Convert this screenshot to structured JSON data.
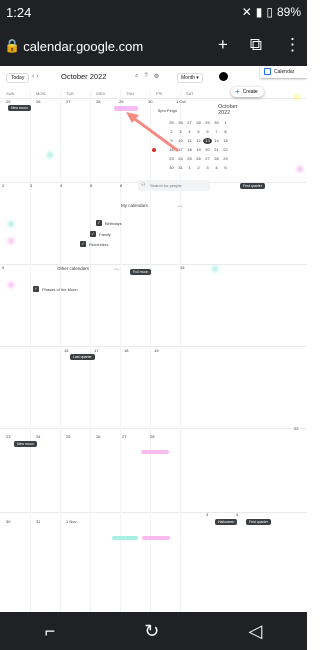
{
  "status_bar": {
    "time": "1:24",
    "battery": "89%"
  },
  "browser": {
    "url": "calendar.google.com"
  },
  "toolbar": {
    "today": "Today",
    "month_label": "October 2022",
    "view": "Month",
    "app_name": "Calendar"
  },
  "days_of_week": [
    "SUN",
    "MON",
    "TUE",
    "WED",
    "THU",
    "FRI",
    "SAT"
  ],
  "week1_dates": [
    "25",
    "26",
    "27",
    "28",
    "29",
    "30",
    "1 Oct"
  ],
  "week2_dates": [
    "2",
    "3",
    "4",
    "5",
    "6",
    "7",
    "8"
  ],
  "week3_dates": [
    "9",
    "10",
    "11",
    "12",
    "13",
    "14",
    "15"
  ],
  "week4_dates": [
    "16",
    "17",
    "18",
    "19",
    "20",
    "21",
    "22"
  ],
  "week5_dates": [
    "23",
    "24",
    "25",
    "26",
    "27",
    "28",
    "29"
  ],
  "week6_dates": [
    "30",
    "31",
    "1 Nov",
    "2",
    "3",
    "4",
    "5"
  ],
  "events": {
    "new_moon_1": "New moon",
    "pingo_time": "5pm",
    "pingo_name": "Pingo",
    "first_quarter_1": "First quarter",
    "full_moon": "Full moon",
    "last_quarter": "Last quarter",
    "new_moon_2": "New moon",
    "halloween": "Halloween",
    "first_quarter_2": "First quarter"
  },
  "create_label": "Create",
  "mini_calendar": {
    "title": "October 2022",
    "days": [
      "25",
      "26",
      "27",
      "28",
      "29",
      "30",
      "1",
      "2",
      "3",
      "4",
      "5",
      "6",
      "7",
      "8",
      "9",
      "10",
      "11",
      "12",
      "13",
      "14",
      "15",
      "16",
      "17",
      "18",
      "19",
      "20",
      "21",
      "22",
      "23",
      "24",
      "25",
      "26",
      "27",
      "28",
      "29",
      "30",
      "31",
      "1",
      "2",
      "3",
      "4",
      "5"
    ]
  },
  "search_people": {
    "placeholder": "Search for people"
  },
  "my_calendars": {
    "title": "My calendars",
    "items": [
      "Birthdays",
      "Family",
      "Reminders"
    ]
  },
  "other_calendars": {
    "title": "Other calendars",
    "items": [
      "Phases of the Moon"
    ]
  },
  "colors": {
    "dark_chip": "#3c4043",
    "accent_blue": "#1a73e8",
    "arrow_red": "#f28b82",
    "drag_pink": "#f8bbf0",
    "drag_teal": "#a8f0e4",
    "mini_today": "#3c4043"
  }
}
